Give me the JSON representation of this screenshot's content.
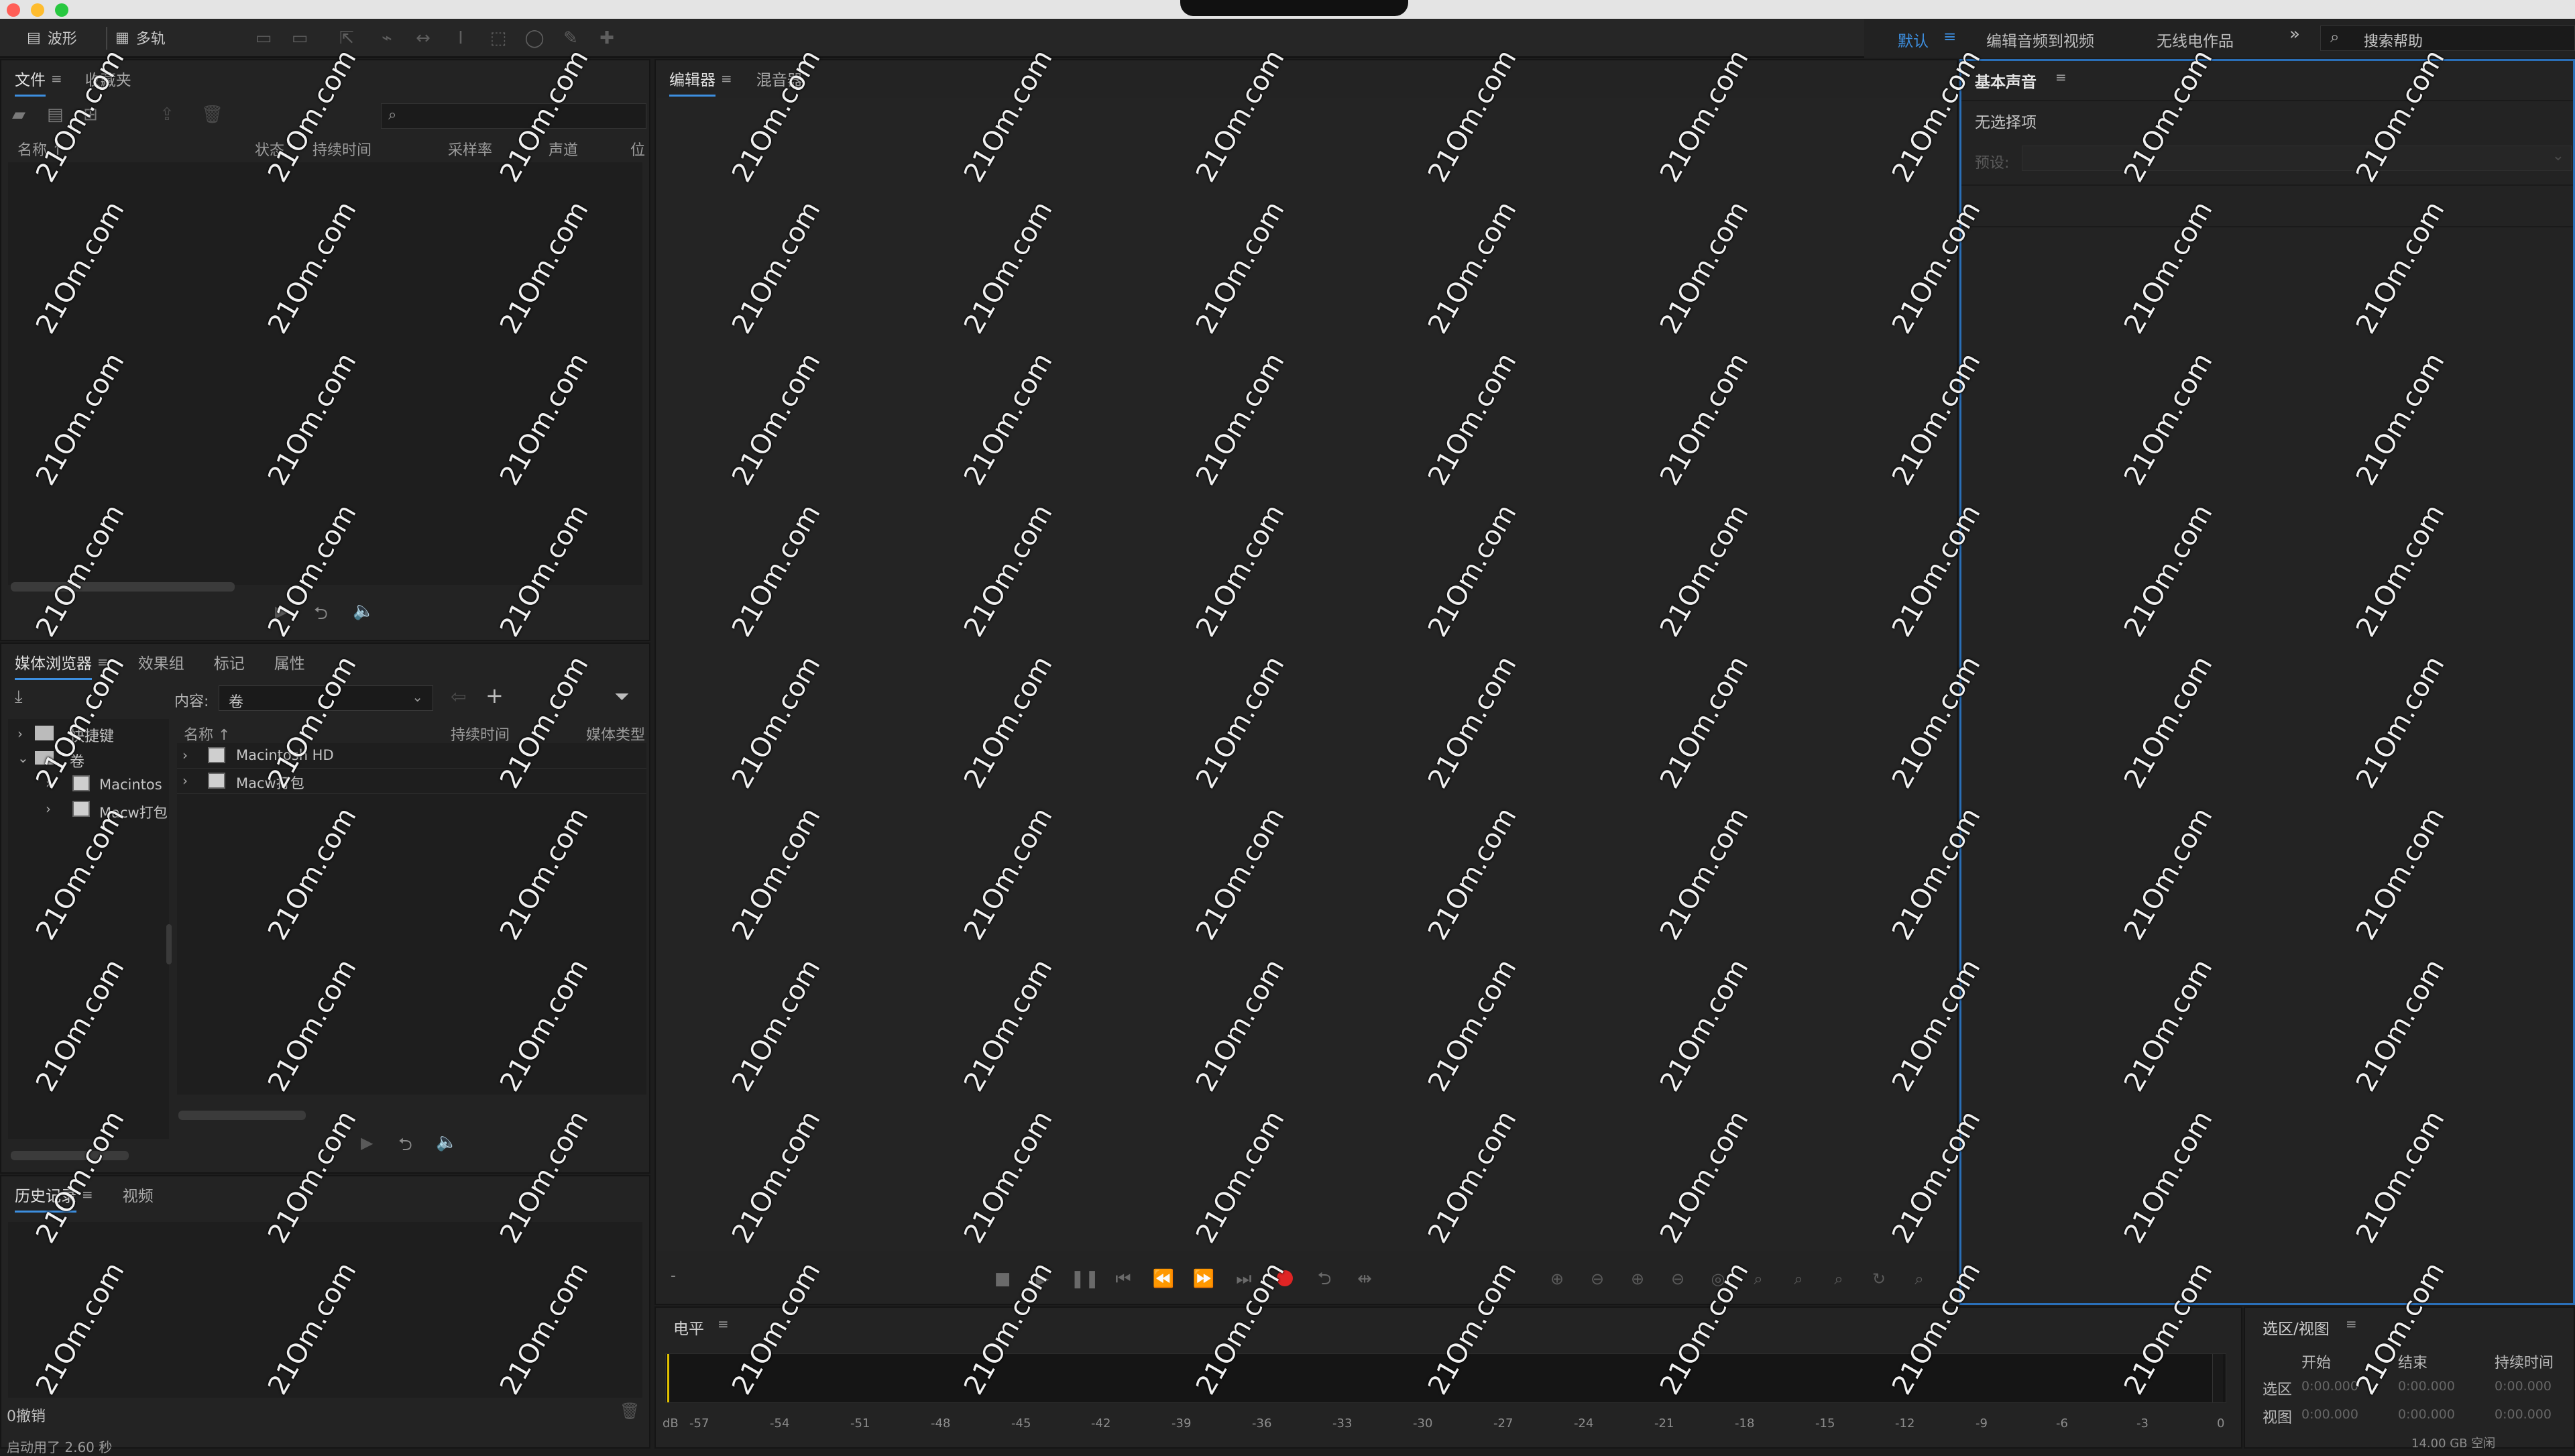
{
  "toolbar": {
    "waveform": "波形",
    "multitrack": "多轨",
    "workspace_default": "默认",
    "workspace_edit_video": "编辑音频到视频",
    "workspace_radio": "无线电作品",
    "more": "»",
    "search_help": "搜索帮助"
  },
  "files_panel": {
    "tabs": [
      "文件",
      "收藏夹"
    ],
    "columns": [
      "名称 ↑",
      "状态",
      "持续时间",
      "采样率",
      "声道",
      "位"
    ]
  },
  "media_panel": {
    "tabs": [
      "媒体浏览器",
      "效果组",
      "标记",
      "属性"
    ],
    "content_label": "内容:",
    "content_value": "卷",
    "tree": [
      "快捷键",
      "卷",
      "Macintos",
      "Macw打包"
    ],
    "columns": [
      "名称 ↑",
      "持续时间",
      "媒体类型"
    ],
    "rows": [
      "Macintosh HD",
      "Macw打包"
    ]
  },
  "history_panel": {
    "tabs": [
      "历史记录",
      "视频"
    ],
    "status": "0撤销",
    "footer": "启动用了 2.60 秒"
  },
  "editor_panel": {
    "tabs": [
      "编辑器",
      "混音器"
    ],
    "dash": "-"
  },
  "essential_sound": {
    "title": "基本声音",
    "no_selection": "无选择项",
    "preset_label": "预设:"
  },
  "levels_panel": {
    "title": "电平",
    "ticks": [
      "dB",
      "-57",
      "-54",
      "-51",
      "-48",
      "-45",
      "-42",
      "-39",
      "-36",
      "-33",
      "-30",
      "-27",
      "-24",
      "-21",
      "-18",
      "-15",
      "-12",
      "-9",
      "-6",
      "-3",
      "0"
    ]
  },
  "selection_view": {
    "title": "选区/视图",
    "col_start": "开始",
    "col_end": "结束",
    "col_duration": "持续时间",
    "row_selection": "选区",
    "row_view": "视图",
    "values": [
      "0:00.000",
      "0:00.000",
      "0:00.000"
    ],
    "disk_free": "14.00 GB 空闲"
  },
  "watermark_text": "21Om.com",
  "colors": {
    "accent": "#3d8fe0",
    "record": "#e02424",
    "level_start": "#e0c000"
  }
}
